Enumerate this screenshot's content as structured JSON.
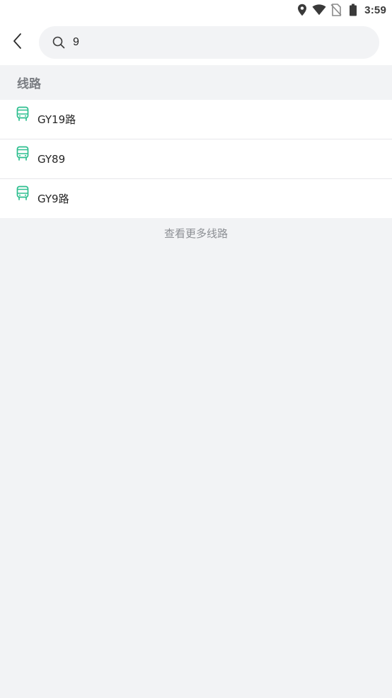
{
  "status_bar": {
    "time": "3:59",
    "icons": [
      "location-icon",
      "wifi-icon",
      "no-sim-icon",
      "battery-icon"
    ]
  },
  "search": {
    "query": "9",
    "back_icon": "back-arrow-icon",
    "search_icon": "search-icon"
  },
  "section": {
    "title": "线路"
  },
  "results": [
    {
      "name": "GY19路",
      "icon": "bus-icon"
    },
    {
      "name": "GY89",
      "icon": "bus-icon"
    },
    {
      "name": "GY9路",
      "icon": "bus-icon"
    }
  ],
  "more": {
    "label": "查看更多线路"
  },
  "colors": {
    "accent": "#2dbf8f",
    "background": "#f2f3f5",
    "surface": "#ffffff",
    "muted_text": "#8c8f94"
  }
}
